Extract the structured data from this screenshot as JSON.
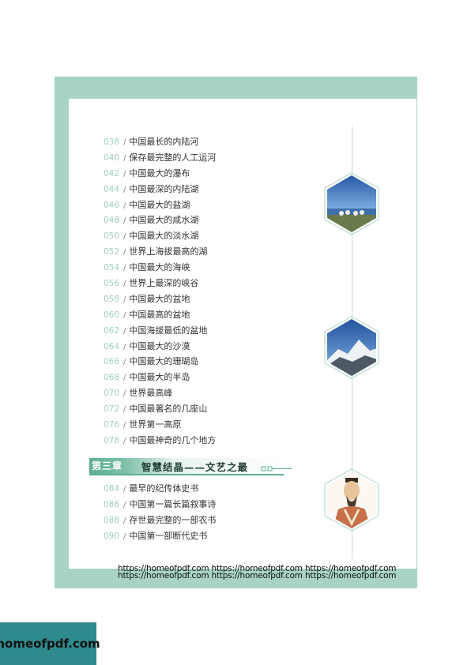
{
  "toc_a": [
    {
      "num": "038",
      "title": "中国最长的内陆河"
    },
    {
      "num": "040",
      "title": "保存最完整的人工运河"
    },
    {
      "num": "042",
      "title": "中国最大的瀑布"
    },
    {
      "num": "044",
      "title": "中国最深的内陆湖"
    },
    {
      "num": "046",
      "title": "中国最大的盐湖"
    },
    {
      "num": "048",
      "title": "中国最大的咸水湖"
    },
    {
      "num": "050",
      "title": "中国最大的淡水湖"
    },
    {
      "num": "052",
      "title": "世界上海拔最高的湖"
    },
    {
      "num": "054",
      "title": "中国最大的海峡"
    },
    {
      "num": "056",
      "title": "世界上最深的峡谷"
    },
    {
      "num": "058",
      "title": "中国最大的盆地"
    },
    {
      "num": "060",
      "title": "中国最高的盆地"
    },
    {
      "num": "062",
      "title": "中国海拔最低的盆地"
    },
    {
      "num": "064",
      "title": "中国最大的沙漠"
    },
    {
      "num": "066",
      "title": "中国最大的珊瑚岛"
    },
    {
      "num": "068",
      "title": "中国最大的半岛"
    },
    {
      "num": "070",
      "title": "世界最高峰"
    },
    {
      "num": "072",
      "title": "中国最著名的几座山"
    },
    {
      "num": "076",
      "title": "世界第一高原"
    },
    {
      "num": "078",
      "title": "中国最神奇的几个地方"
    }
  ],
  "chapter": {
    "label": "第三章",
    "title": "智慧结晶——文艺之最"
  },
  "toc_b": [
    {
      "num": "084",
      "title": "最早的纪传体史书"
    },
    {
      "num": "086",
      "title": "中国第一篇长篇叙事诗"
    },
    {
      "num": "088",
      "title": "存世最完整的一部农书"
    },
    {
      "num": "090",
      "title": "中国第一部断代史书"
    }
  ],
  "separator": "/",
  "watermark": {
    "line1": "https://homeofpdf.com https://homeofpdf.com https://homeofpdf.com",
    "line2": "https://homeofpdf.com https://homeofpdf.com https://homeofpdf.com"
  },
  "logo_text": "homeofpdf.com",
  "colors": {
    "frame": "#a9d3c2",
    "accent": "#5fae96",
    "number": "#9fcfbe"
  }
}
